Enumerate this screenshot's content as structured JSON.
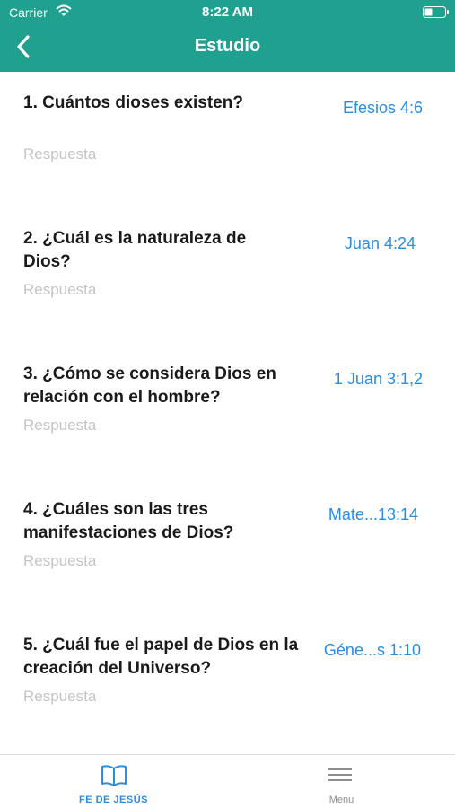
{
  "status_bar": {
    "carrier": "Carrier",
    "time": "8:22 AM"
  },
  "nav": {
    "title": "Estudio",
    "back_icon": "chevron-left-icon"
  },
  "colors": {
    "header": "#20a08e",
    "link": "#2a8de0",
    "placeholder": "#c4c4c4"
  },
  "questions": [
    {
      "text": "1. Cuántos dioses existen?",
      "ref": "Efesios 4:6",
      "answer_placeholder": "Respuesta"
    },
    {
      "text": "2. ¿Cuál es la naturaleza de Dios?",
      "ref": "Juan 4:24",
      "answer_placeholder": "Respuesta"
    },
    {
      "text": "3. ¿Cómo se considera Dios en relación con el hombre?",
      "ref": "1 Juan 3:1,2",
      "answer_placeholder": "Respuesta"
    },
    {
      "text": "4. ¿Cuáles son las tres manifestaciones de Dios?",
      "ref": "Mate...13:14",
      "answer_placeholder": "Respuesta"
    },
    {
      "text": "5. ¿Cuál fue el papel de Dios en la creación del Universo?",
      "ref": "Géne...s 1:10",
      "answer_placeholder": "Respuesta"
    }
  ],
  "tabs": [
    {
      "label": "FE DE JESÚS",
      "icon": "book-icon",
      "selected": true
    },
    {
      "label": "Menu",
      "icon": "menu-icon",
      "selected": false
    }
  ]
}
